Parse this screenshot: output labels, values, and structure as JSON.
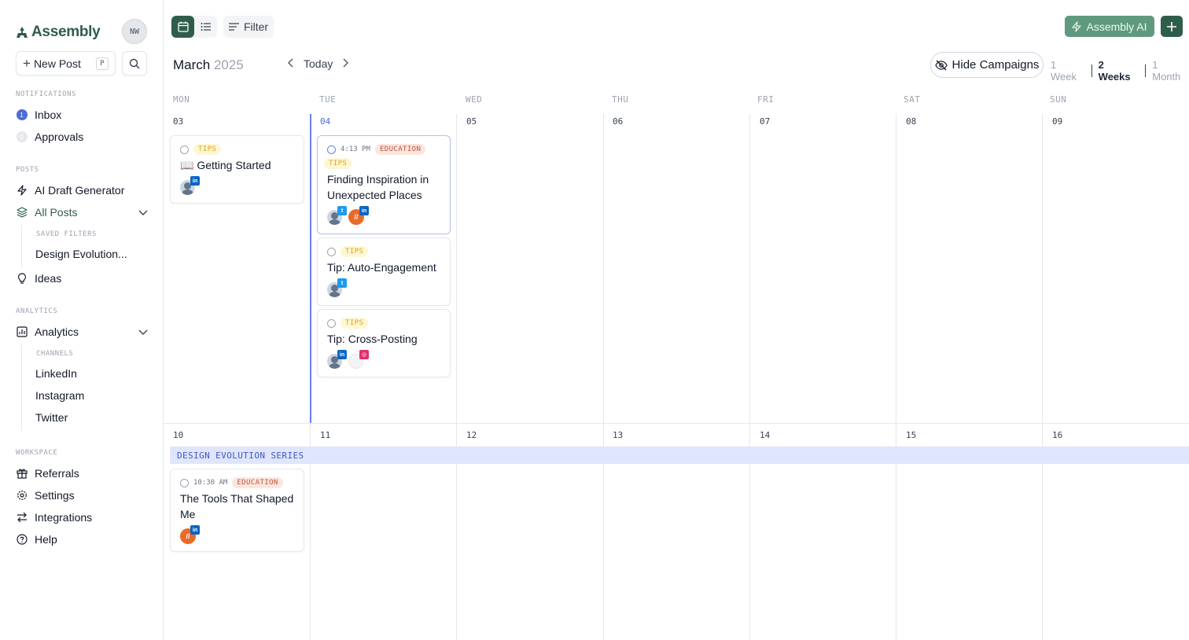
{
  "sidebar": {
    "logo": "Assembly",
    "user_initials": "NW",
    "new_post_label": "New Post",
    "new_post_shortcut": "P",
    "notifications_label": "NOTIFICATIONS",
    "inbox_label": "Inbox",
    "inbox_count": "1",
    "approvals_label": "Approvals",
    "approvals_count": "0",
    "posts_label": "POSTS",
    "ai_draft_label": "AI Draft Generator",
    "all_posts_label": "All Posts",
    "saved_filters_label": "SAVED FILTERS",
    "saved_filter_1": "Design Evolution...",
    "ideas_label": "Ideas",
    "analytics_section_label": "ANALYTICS",
    "analytics_label": "Analytics",
    "channels_label": "CHANNELS",
    "channel_1": "LinkedIn",
    "channel_2": "Instagram",
    "channel_3": "Twitter",
    "workspace_label": "WORKSPACE",
    "referrals_label": "Referrals",
    "settings_label": "Settings",
    "integrations_label": "Integrations",
    "help_label": "Help"
  },
  "toolbar": {
    "filter_label": "Filter",
    "ai_label": "Assembly AI",
    "month": "March",
    "year": "2025",
    "today_label": "Today",
    "hide_campaigns_label": "Hide Campaigns",
    "range_1": "1 Week",
    "range_2": "2 Weeks",
    "range_3": "1 Month"
  },
  "calendar": {
    "dows": [
      "MON",
      "TUE",
      "WED",
      "THU",
      "FRI",
      "SAT",
      "SUN"
    ],
    "week1": [
      "03",
      "04",
      "05",
      "06",
      "07",
      "08",
      "09"
    ],
    "week2": [
      "10",
      "11",
      "12",
      "13",
      "14",
      "15",
      "16"
    ],
    "campaign": "DESIGN EVOLUTION SERIES"
  },
  "posts": {
    "p1": {
      "tag": "TIPS",
      "title": "📖 Getting Started"
    },
    "p2": {
      "time": "4:13 PM",
      "tag1": "EDUCATION",
      "tag2": "TIPS",
      "title": "Finding Inspiration in Unexpected Places"
    },
    "p3": {
      "tag": "TIPS",
      "title": "Tip: Auto-Engagement"
    },
    "p4": {
      "tag": "TIPS",
      "title": "Tip: Cross-Posting"
    },
    "p5": {
      "time": "10:30 AM",
      "tag": "EDUCATION",
      "title": "The Tools That Shaped Me"
    }
  },
  "colors": {
    "brand": "#2f5d4b",
    "today": "#6b7ff0",
    "campaign_bg": "#dfe5fb"
  }
}
